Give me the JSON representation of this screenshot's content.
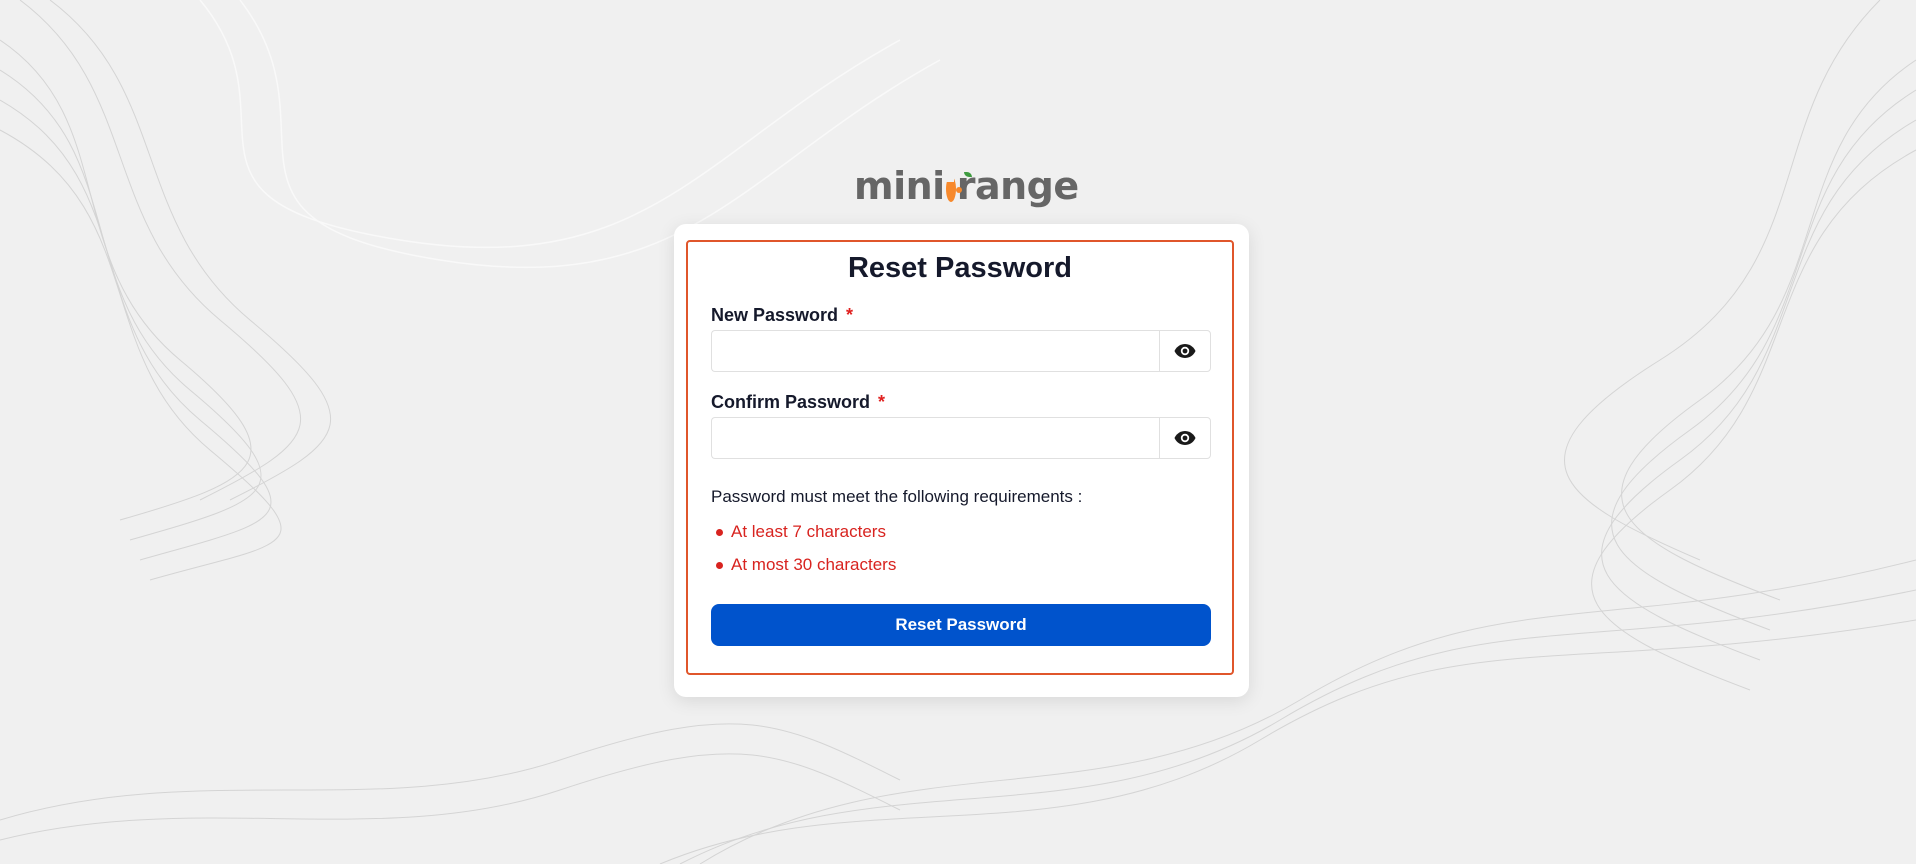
{
  "brand": {
    "logo_prefix": "mini",
    "logo_suffix": "range",
    "accent_color": "#f7892c"
  },
  "form": {
    "title": "Reset Password",
    "new_password": {
      "label": "New Password",
      "required_mark": "*",
      "value": "",
      "toggle_icon": "eye-icon"
    },
    "confirm_password": {
      "label": "Confirm Password",
      "required_mark": "*",
      "value": "",
      "toggle_icon": "eye-icon"
    },
    "requirements_heading": "Password must meet the following requirements :",
    "requirements": [
      "At least 7 characters",
      "At most 30 characters"
    ],
    "submit_label": "Reset Password",
    "colors": {
      "border": "#e0562b",
      "button": "#0053cc",
      "requirement_text": "#d8231f"
    }
  }
}
